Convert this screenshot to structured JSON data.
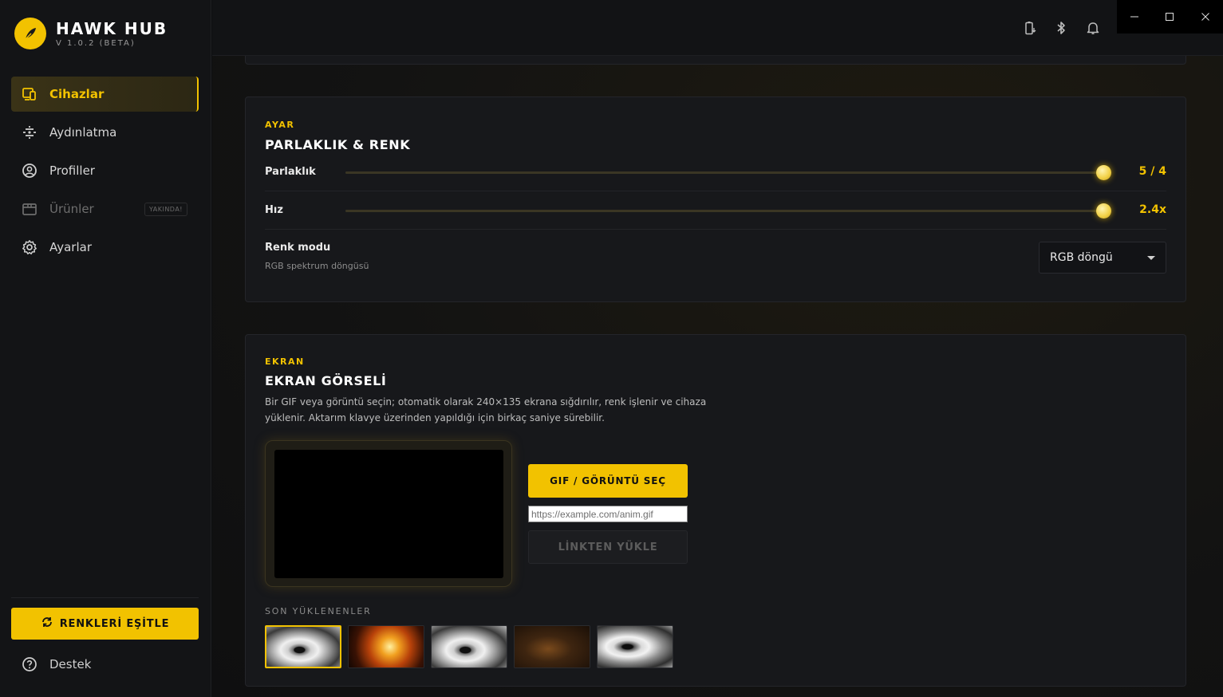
{
  "brand": {
    "name": "HAWK HUB",
    "version": "V 1.0.2 (BETA)"
  },
  "sidebar": {
    "items": [
      {
        "label": "Cihazlar",
        "icon": "devices-icon",
        "active": true
      },
      {
        "label": "Aydınlatma",
        "icon": "lighting-icon"
      },
      {
        "label": "Profiller",
        "icon": "profile-icon"
      },
      {
        "label": "Ürünler",
        "icon": "store-icon",
        "disabled": true,
        "badge": "YAKINDA!"
      },
      {
        "label": "Ayarlar",
        "icon": "gear-icon"
      }
    ],
    "sync_button": "RENKLERİ EŞİTLE",
    "support": "Destek"
  },
  "colors": {
    "accent": "#f2c200",
    "background": "#0d0e10",
    "card": "#17181b"
  },
  "settings_card": {
    "eyebrow": "AYAR",
    "title": "PARLAKLIK & RENK",
    "brightness": {
      "label": "Parlaklık",
      "value": "5 / 4",
      "level": 1.0
    },
    "speed": {
      "label": "Hız",
      "value": "2.4x",
      "level": 1.0
    },
    "color_mode": {
      "label": "Renk modu",
      "sub": "RGB spektrum döngüsü",
      "selected": "RGB döngü"
    }
  },
  "screen_card": {
    "eyebrow": "EKRAN",
    "title": "EKRAN GÖRSELİ",
    "description": "Bir GIF veya görüntü seçin; otomatik olarak 240×135 ekrana sığdırılır, renk işlenir ve cihaza yüklenir. Aktarım klavye üzerinden yapıldığı için birkaç saniye sürebilir.",
    "pick_button": "GIF / GÖRÜNTÜ SEÇ",
    "url_placeholder": "https://example.com/anim.gif",
    "link_button": "LİNKTEN YÜKLE",
    "recent_label": "SON YÜKLENENLER"
  }
}
